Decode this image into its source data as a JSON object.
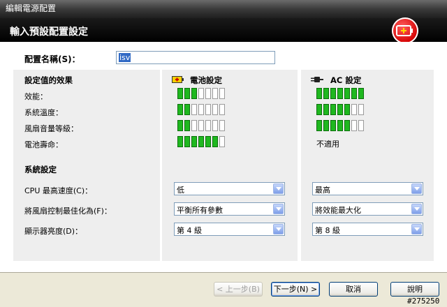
{
  "window": {
    "title": "編輯電源配置"
  },
  "header": {
    "title": "輸入預設配置設定",
    "icon": "battery-plus-icon",
    "icon_color": "#d40000"
  },
  "profile": {
    "label": "配置名稱(S)：",
    "value": "isv"
  },
  "effects": {
    "title": "設定值的效果",
    "rows": [
      "效能：",
      "系統溫度：",
      "風扇音量等級：",
      "電池壽命："
    ]
  },
  "battery": {
    "title": "電池設定",
    "levels": [
      3,
      2,
      2,
      6
    ],
    "settings": [
      "低",
      "平衡所有參數",
      "第 4 級"
    ]
  },
  "ac": {
    "title": "AC 設定",
    "levels": [
      7,
      5,
      5
    ],
    "not_applicable": "不適用",
    "settings": [
      "最高",
      "將效能最大化",
      "第 8 級"
    ]
  },
  "bar_segments": 7,
  "system": {
    "title": "系統設定",
    "rows": [
      "CPU 最高速度(C)：",
      "將風扇控制最佳化為(F)：",
      "顯示器亮度(D)："
    ]
  },
  "buttons": {
    "back": "< 上一步(B)",
    "next": "下一步(N) >",
    "cancel": "取消",
    "help": "說明"
  },
  "watermark": "#275250",
  "colors": {
    "bar_on": "#1fb81f",
    "accent": "#316ac5"
  }
}
